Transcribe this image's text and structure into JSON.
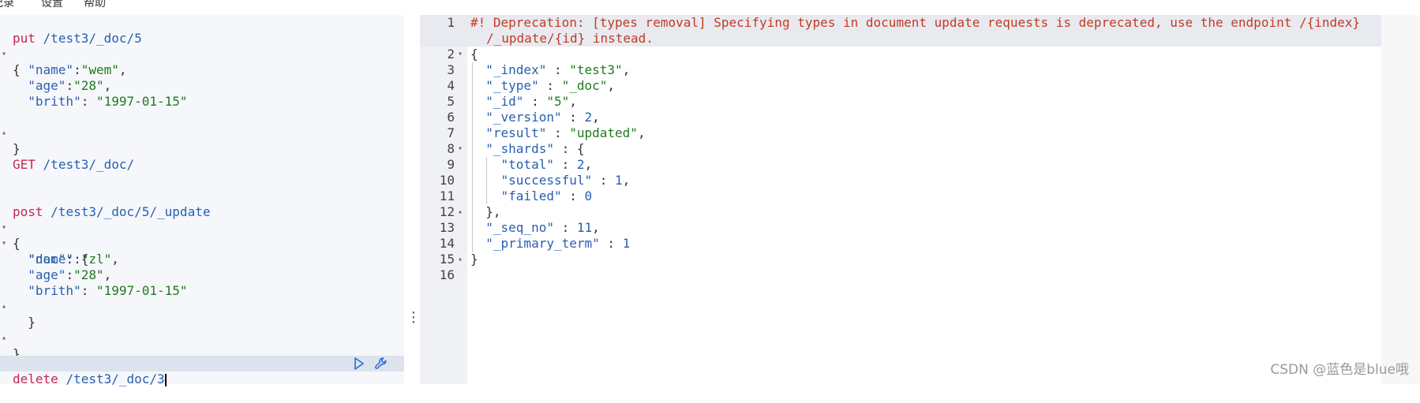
{
  "menu": {
    "items": [
      "记录",
      "设置",
      "帮助"
    ]
  },
  "request_editor": {
    "block1": {
      "method": "put",
      "url": "/test3/_doc/5",
      "open": "{",
      "fields": [
        {
          "key": "\"name\"",
          "sep": ":",
          "value": "\"wem\"",
          "tail": ","
        },
        {
          "key": "\"age\"",
          "sep": ":",
          "value": "\"28\"",
          "tail": ","
        },
        {
          "key": "\"brith\"",
          "sep": ": ",
          "value": "\"1997-01-15\"",
          "tail": ""
        }
      ],
      "close": "}"
    },
    "block2": {
      "method": "GET",
      "url": "/test3/_doc/"
    },
    "block3": {
      "method": "post",
      "url": "/test3/_doc/5/_update",
      "open": "{",
      "doc_key": "\"doc\"",
      "doc_open": ": {",
      "fields": [
        {
          "key": "\"name\"",
          "sep": ":",
          "value": "\"zl\"",
          "tail": ","
        },
        {
          "key": "\"age\"",
          "sep": ":",
          "value": "\"28\"",
          "tail": ","
        },
        {
          "key": "\"brith\"",
          "sep": ": ",
          "value": "\"1997-01-15\"",
          "tail": ""
        }
      ],
      "doc_close": "}",
      "close": "}"
    },
    "block4": {
      "method": "delete",
      "url": "/test3/_doc/3"
    }
  },
  "response": {
    "line_numbers": [
      "1",
      "2",
      "3",
      "4",
      "5",
      "6",
      "7",
      "8",
      "9",
      "10",
      "11",
      "12",
      "13",
      "14",
      "15",
      "16"
    ],
    "warning_1": "#! Deprecation: [types removal] Specifying types in document update requests is deprecated, use the endpoint /{index}",
    "warning_2": "/_update/{id} instead.",
    "l2": "{",
    "index_key": "\"_index\"",
    "index_val": "\"test3\"",
    "type_key": "\"_type\"",
    "type_val": "\"_doc\"",
    "id_key": "\"_id\"",
    "id_val": "\"5\"",
    "version_key": "\"_version\"",
    "version_val": "2",
    "result_key": "\"result\"",
    "result_val": "\"updated\"",
    "shards_key": "\"_shards\"",
    "shards_open": " : {",
    "total_key": "\"total\"",
    "total_val": "2",
    "successful_key": "\"successful\"",
    "successful_val": "1",
    "failed_key": "\"failed\"",
    "failed_val": "0",
    "shards_close": "},",
    "seq_key": "\"_seq_no\"",
    "seq_val": "11",
    "term_key": "\"_primary_term\"",
    "term_val": "1",
    "l15": "}"
  },
  "watermark": "CSDN @蓝色是blue哦"
}
